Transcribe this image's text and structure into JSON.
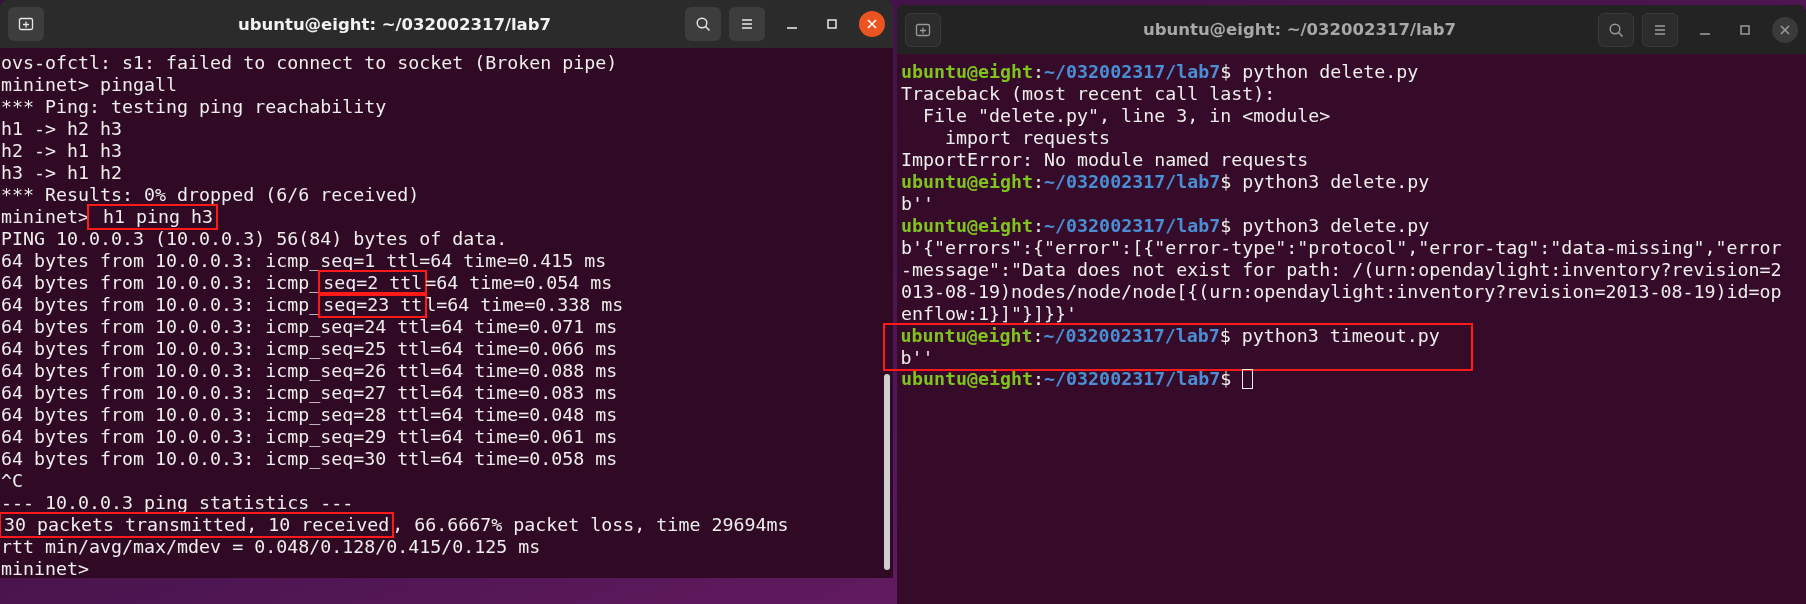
{
  "windows": [
    {
      "title": "ubuntu@eight: ~/032002317/lab7",
      "focused": true,
      "scrollbar": true,
      "lines": [
        {
          "kind": "text",
          "segments": [
            {
              "text": "ovs-ofctl: s1: failed to connect to socket (Broken pipe)",
              "highlighted": false
            }
          ]
        },
        {
          "kind": "text",
          "segments": [
            {
              "text": "mininet> pingall",
              "highlighted": false
            }
          ]
        },
        {
          "kind": "text",
          "segments": [
            {
              "text": "*** Ping: testing ping reachability",
              "highlighted": false
            }
          ]
        },
        {
          "kind": "text",
          "segments": [
            {
              "text": "h1 -> h2 h3",
              "highlighted": false
            }
          ]
        },
        {
          "kind": "text",
          "segments": [
            {
              "text": "h2 -> h1 h3",
              "highlighted": false
            }
          ]
        },
        {
          "kind": "text",
          "segments": [
            {
              "text": "h3 -> h1 h2",
              "highlighted": false
            }
          ]
        },
        {
          "kind": "text",
          "segments": [
            {
              "text": "*** Results: 0% dropped (6/6 received)",
              "highlighted": false
            }
          ]
        },
        {
          "kind": "text",
          "segments": [
            {
              "text": "mininet>",
              "highlighted": false
            },
            {
              "text": " h1 ping h3",
              "highlighted": true
            }
          ]
        },
        {
          "kind": "text",
          "segments": [
            {
              "text": "PING 10.0.0.3 (10.0.0.3) 56(84) bytes of data.",
              "highlighted": false
            }
          ]
        },
        {
          "kind": "text",
          "segments": [
            {
              "text": "64 bytes from 10.0.0.3: icmp_seq=1 ttl=64 time=0.415 ms",
              "highlighted": false
            }
          ]
        },
        {
          "kind": "text",
          "segments": [
            {
              "text": "64 bytes from 10.0.0.3: icmp_",
              "highlighted": false
            },
            {
              "text": "seq=2 ttl",
              "highlighted": true
            },
            {
              "text": "=64 time=0.054 ms",
              "highlighted": false
            }
          ]
        },
        {
          "kind": "text",
          "segments": [
            {
              "text": "64 bytes from 10.0.0.3: icmp_",
              "highlighted": false
            },
            {
              "text": "seq=23 tt",
              "highlighted": true
            },
            {
              "text": "l=64 time=0.338 ms",
              "highlighted": false
            }
          ]
        },
        {
          "kind": "text",
          "segments": [
            {
              "text": "64 bytes from 10.0.0.3: icmp_seq=24 ttl=64 time=0.071 ms",
              "highlighted": false
            }
          ]
        },
        {
          "kind": "text",
          "segments": [
            {
              "text": "64 bytes from 10.0.0.3: icmp_seq=25 ttl=64 time=0.066 ms",
              "highlighted": false
            }
          ]
        },
        {
          "kind": "text",
          "segments": [
            {
              "text": "64 bytes from 10.0.0.3: icmp_seq=26 ttl=64 time=0.088 ms",
              "highlighted": false
            }
          ]
        },
        {
          "kind": "text",
          "segments": [
            {
              "text": "64 bytes from 10.0.0.3: icmp_seq=27 ttl=64 time=0.083 ms",
              "highlighted": false
            }
          ]
        },
        {
          "kind": "text",
          "segments": [
            {
              "text": "64 bytes from 10.0.0.3: icmp_seq=28 ttl=64 time=0.048 ms",
              "highlighted": false
            }
          ]
        },
        {
          "kind": "text",
          "segments": [
            {
              "text": "64 bytes from 10.0.0.3: icmp_seq=29 ttl=64 time=0.061 ms",
              "highlighted": false
            }
          ]
        },
        {
          "kind": "text",
          "segments": [
            {
              "text": "64 bytes from 10.0.0.3: icmp_seq=30 ttl=64 time=0.058 ms",
              "highlighted": false
            }
          ]
        },
        {
          "kind": "text",
          "segments": [
            {
              "text": "^C",
              "highlighted": false
            }
          ]
        },
        {
          "kind": "text",
          "segments": [
            {
              "text": "--- 10.0.0.3 ping statistics ---",
              "highlighted": false
            }
          ]
        },
        {
          "kind": "text",
          "segments": [
            {
              "text": "30 packets transmitted, 10 received",
              "highlighted": true
            },
            {
              "text": ", 66.6667% packet loss, time 29694ms",
              "highlighted": false
            }
          ]
        },
        {
          "kind": "text",
          "segments": [
            {
              "text": "rtt min/avg/max/mdev = 0.048/0.128/0.415/0.125 ms",
              "highlighted": false
            }
          ]
        },
        {
          "kind": "text",
          "segments": [
            {
              "text": "mininet>",
              "highlighted": false
            }
          ]
        }
      ]
    },
    {
      "title": "ubuntu@eight: ~/032002317/lab7",
      "focused": false,
      "lines": [
        {
          "kind": "prompt",
          "highlighted": false,
          "user": "ubuntu@eight",
          "sep": ":",
          "path": "~/032002317/lab7",
          "symbol": "$",
          "text": "python delete.py"
        },
        {
          "kind": "text",
          "highlighted": false,
          "segments": [
            {
              "text": "Traceback (most recent call last):",
              "highlighted": false
            }
          ]
        },
        {
          "kind": "text",
          "highlighted": false,
          "segments": [
            {
              "text": "  File \"delete.py\", line 3, in <module>",
              "highlighted": false
            }
          ]
        },
        {
          "kind": "text",
          "highlighted": false,
          "segments": [
            {
              "text": "    import requests",
              "highlighted": false
            }
          ]
        },
        {
          "kind": "text",
          "highlighted": false,
          "segments": [
            {
              "text": "ImportError: No module named requests",
              "highlighted": false
            }
          ]
        },
        {
          "kind": "prompt",
          "highlighted": false,
          "user": "ubuntu@eight",
          "sep": ":",
          "path": "~/032002317/lab7",
          "symbol": "$",
          "text": "python3 delete.py"
        },
        {
          "kind": "text",
          "highlighted": false,
          "segments": [
            {
              "text": "b''",
              "highlighted": false
            }
          ]
        },
        {
          "kind": "prompt",
          "highlighted": false,
          "user": "ubuntu@eight",
          "sep": ":",
          "path": "~/032002317/lab7",
          "symbol": "$",
          "text": "python3 delete.py"
        },
        {
          "kind": "text",
          "highlighted": false,
          "segments": [
            {
              "text": "b'{\"errors\":{\"error\":[{\"error-type\":\"protocol\",\"error-tag\":\"data-missing\",\"error",
              "highlighted": false
            }
          ]
        },
        {
          "kind": "text",
          "highlighted": false,
          "segments": [
            {
              "text": "-message\":\"Data does not exist for path: /(urn:opendaylight:inventory?revision=2",
              "highlighted": false
            }
          ]
        },
        {
          "kind": "text",
          "highlighted": false,
          "segments": [
            {
              "text": "013-08-19)nodes/node/node[{(urn:opendaylight:inventory?revision=2013-08-19)id=op",
              "highlighted": false
            }
          ]
        },
        {
          "kind": "text",
          "highlighted": false,
          "segments": [
            {
              "text": "enflow:1}]\"}]}}'",
              "highlighted": false
            }
          ]
        },
        {
          "kind": "prompt",
          "highlighted": true,
          "user": "ubuntu@eight",
          "sep": ":",
          "path": "~/032002317/lab7",
          "symbol": "$",
          "text": "python3 timeout.py"
        },
        {
          "kind": "text",
          "highlighted": true,
          "segments": [
            {
              "text": "b''",
              "highlighted": false
            }
          ]
        },
        {
          "kind": "prompt",
          "highlighted": false,
          "user": "ubuntu@eight",
          "sep": ":",
          "path": "~/032002317/lab7",
          "symbol": "$",
          "cursor": true
        }
      ]
    }
  ]
}
